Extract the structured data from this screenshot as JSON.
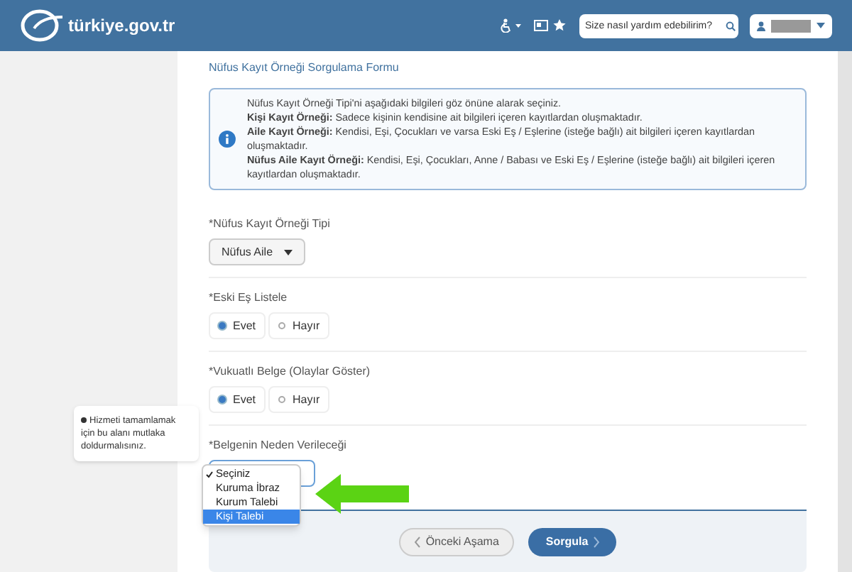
{
  "header": {
    "logo": "türkiye.gov.tr",
    "search": {
      "placeholder": "Size nasıl yardım edebilirim?"
    }
  },
  "form": {
    "title": "Nüfus Kayıt Örneği Sorgulama Formu",
    "info": [
      "Nüfus Kayıt Örneği Tipi'ni aşağıdaki bilgileri göz önüne alarak seçiniz.",
      "**Kişi Kayıt Örneği:** Sadece kişinin kendisine ait bilgileri içeren kayıtlardan oluşmaktadır.",
      "**Aile Kayıt Örneği:** Kendisi, Eşi, Çocukları ve varsa Eski Eş / Eşlerine (isteğe bağlı) ait bilgileri içeren kayıtlardan oluşmaktadır.",
      "**Nüfus Aile Kayıt Örneği:** Kendisi, Eşi, Çocukları, Anne / Babası ve Eski Eş / Eşlerine (isteğe bağlı) ait bilgileri içeren kayıtlardan oluşmaktadır."
    ],
    "fields": [
      {
        "kind": "select",
        "label": "*Nüfus Kayıt Örneği Tipi",
        "value": "Nüfus Aile"
      },
      {
        "kind": "radio",
        "label": "*Eski Eş Listele",
        "options": [
          {
            "label": "Evet",
            "selected": true
          },
          {
            "label": "Hayır",
            "selected": false
          }
        ]
      },
      {
        "kind": "radio",
        "label": "*Vukuatlı Belge (Olaylar Göster)",
        "options": [
          {
            "label": "Evet",
            "selected": true
          },
          {
            "label": "Hayır",
            "selected": false
          }
        ]
      },
      {
        "kind": "dropdown",
        "label": "*Belgenin Neden Verileceği",
        "options": [
          {
            "label": "Seçiniz",
            "checked": true,
            "highlighted": false
          },
          {
            "label": "Kuruma İbraz",
            "checked": false,
            "highlighted": false
          },
          {
            "label": "Kurum Talebi",
            "checked": false,
            "highlighted": false
          },
          {
            "label": "Kişi Talebi",
            "checked": false,
            "highlighted": true
          }
        ]
      }
    ]
  },
  "tooltip": "Hizmeti tamamlamak için bu alanı mutlaka doldurmalısınız.",
  "buttons": [
    {
      "kind": "back",
      "label": "Önceki Aşama"
    },
    {
      "kind": "submit",
      "label": "Sorgula"
    }
  ]
}
